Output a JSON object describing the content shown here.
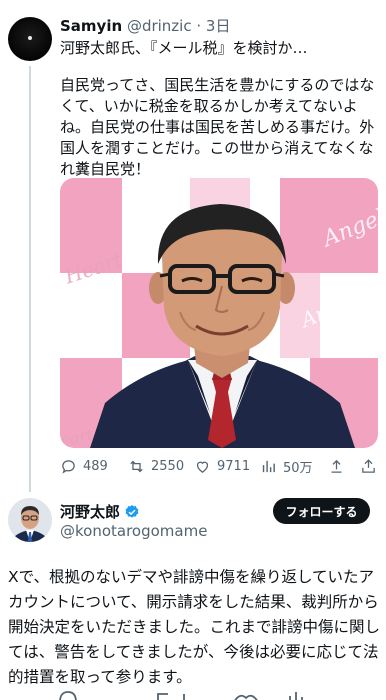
{
  "parent_tweet": {
    "display_name": "Samyin",
    "handle": "@drinzic",
    "dot": " · ",
    "time": "3日",
    "title": "河野太郎氏、『メール税』を検討か…",
    "body": "自民党ってさ、国民生活を豊かにするのではなくて、いかに税金を取るかしか考えてないよね。自民党の仕事は国民を苦しめる事だけ。外国人を潤すことだけ。この世から消えてなくなれ糞自民党！",
    "photo_watermarks": [
      "Angel",
      "Angel",
      "Heart",
      "eart"
    ],
    "actions": {
      "replies": "489",
      "reposts": "2550",
      "likes": "9711",
      "views": "50万"
    }
  },
  "reply_tweet": {
    "display_name": "河野太郎",
    "verified": true,
    "handle": "@konotarogomame",
    "follow_label": "フォローする",
    "body": "Xで、根拠のないデマや誹謗中傷を繰り返していたアカウントについて、開示請求をした結果、裁判所から開始決定をいただきました。これまで誹謗中傷に関しては、警告をしてきましたが、今後は必要に応じて法的措置を取って参ります。"
  },
  "colors": {
    "text": "#0f1419",
    "secondary": "#536471",
    "verified_blue": "#1d9bf0",
    "thread_line": "#cfd9de",
    "pink": "#f2a3bf"
  },
  "icons": [
    "reply-icon",
    "repost-icon",
    "like-icon",
    "views-icon",
    "share-icon",
    "verified-badge-icon"
  ]
}
